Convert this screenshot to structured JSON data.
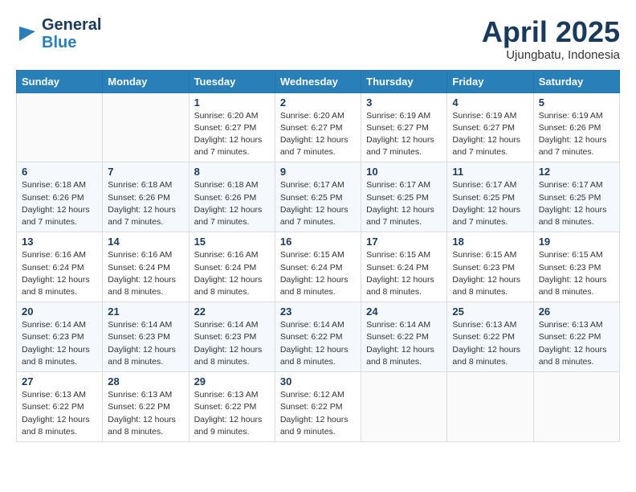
{
  "header": {
    "logo_line1": "General",
    "logo_line2": "Blue",
    "month": "April 2025",
    "location": "Ujungbatu, Indonesia"
  },
  "weekdays": [
    "Sunday",
    "Monday",
    "Tuesday",
    "Wednesday",
    "Thursday",
    "Friday",
    "Saturday"
  ],
  "weeks": [
    [
      {
        "day": "",
        "info": ""
      },
      {
        "day": "",
        "info": ""
      },
      {
        "day": "1",
        "info": "Sunrise: 6:20 AM\nSunset: 6:27 PM\nDaylight: 12 hours\nand 7 minutes."
      },
      {
        "day": "2",
        "info": "Sunrise: 6:20 AM\nSunset: 6:27 PM\nDaylight: 12 hours\nand 7 minutes."
      },
      {
        "day": "3",
        "info": "Sunrise: 6:19 AM\nSunset: 6:27 PM\nDaylight: 12 hours\nand 7 minutes."
      },
      {
        "day": "4",
        "info": "Sunrise: 6:19 AM\nSunset: 6:27 PM\nDaylight: 12 hours\nand 7 minutes."
      },
      {
        "day": "5",
        "info": "Sunrise: 6:19 AM\nSunset: 6:26 PM\nDaylight: 12 hours\nand 7 minutes."
      }
    ],
    [
      {
        "day": "6",
        "info": "Sunrise: 6:18 AM\nSunset: 6:26 PM\nDaylight: 12 hours\nand 7 minutes."
      },
      {
        "day": "7",
        "info": "Sunrise: 6:18 AM\nSunset: 6:26 PM\nDaylight: 12 hours\nand 7 minutes."
      },
      {
        "day": "8",
        "info": "Sunrise: 6:18 AM\nSunset: 6:26 PM\nDaylight: 12 hours\nand 7 minutes."
      },
      {
        "day": "9",
        "info": "Sunrise: 6:17 AM\nSunset: 6:25 PM\nDaylight: 12 hours\nand 7 minutes."
      },
      {
        "day": "10",
        "info": "Sunrise: 6:17 AM\nSunset: 6:25 PM\nDaylight: 12 hours\nand 7 minutes."
      },
      {
        "day": "11",
        "info": "Sunrise: 6:17 AM\nSunset: 6:25 PM\nDaylight: 12 hours\nand 7 minutes."
      },
      {
        "day": "12",
        "info": "Sunrise: 6:17 AM\nSunset: 6:25 PM\nDaylight: 12 hours\nand 8 minutes."
      }
    ],
    [
      {
        "day": "13",
        "info": "Sunrise: 6:16 AM\nSunset: 6:24 PM\nDaylight: 12 hours\nand 8 minutes."
      },
      {
        "day": "14",
        "info": "Sunrise: 6:16 AM\nSunset: 6:24 PM\nDaylight: 12 hours\nand 8 minutes."
      },
      {
        "day": "15",
        "info": "Sunrise: 6:16 AM\nSunset: 6:24 PM\nDaylight: 12 hours\nand 8 minutes."
      },
      {
        "day": "16",
        "info": "Sunrise: 6:15 AM\nSunset: 6:24 PM\nDaylight: 12 hours\nand 8 minutes."
      },
      {
        "day": "17",
        "info": "Sunrise: 6:15 AM\nSunset: 6:24 PM\nDaylight: 12 hours\nand 8 minutes."
      },
      {
        "day": "18",
        "info": "Sunrise: 6:15 AM\nSunset: 6:23 PM\nDaylight: 12 hours\nand 8 minutes."
      },
      {
        "day": "19",
        "info": "Sunrise: 6:15 AM\nSunset: 6:23 PM\nDaylight: 12 hours\nand 8 minutes."
      }
    ],
    [
      {
        "day": "20",
        "info": "Sunrise: 6:14 AM\nSunset: 6:23 PM\nDaylight: 12 hours\nand 8 minutes."
      },
      {
        "day": "21",
        "info": "Sunrise: 6:14 AM\nSunset: 6:23 PM\nDaylight: 12 hours\nand 8 minutes."
      },
      {
        "day": "22",
        "info": "Sunrise: 6:14 AM\nSunset: 6:23 PM\nDaylight: 12 hours\nand 8 minutes."
      },
      {
        "day": "23",
        "info": "Sunrise: 6:14 AM\nSunset: 6:22 PM\nDaylight: 12 hours\nand 8 minutes."
      },
      {
        "day": "24",
        "info": "Sunrise: 6:14 AM\nSunset: 6:22 PM\nDaylight: 12 hours\nand 8 minutes."
      },
      {
        "day": "25",
        "info": "Sunrise: 6:13 AM\nSunset: 6:22 PM\nDaylight: 12 hours\nand 8 minutes."
      },
      {
        "day": "26",
        "info": "Sunrise: 6:13 AM\nSunset: 6:22 PM\nDaylight: 12 hours\nand 8 minutes."
      }
    ],
    [
      {
        "day": "27",
        "info": "Sunrise: 6:13 AM\nSunset: 6:22 PM\nDaylight: 12 hours\nand 8 minutes."
      },
      {
        "day": "28",
        "info": "Sunrise: 6:13 AM\nSunset: 6:22 PM\nDaylight: 12 hours\nand 8 minutes."
      },
      {
        "day": "29",
        "info": "Sunrise: 6:13 AM\nSunset: 6:22 PM\nDaylight: 12 hours\nand 9 minutes."
      },
      {
        "day": "30",
        "info": "Sunrise: 6:12 AM\nSunset: 6:22 PM\nDaylight: 12 hours\nand 9 minutes."
      },
      {
        "day": "",
        "info": ""
      },
      {
        "day": "",
        "info": ""
      },
      {
        "day": "",
        "info": ""
      }
    ]
  ]
}
